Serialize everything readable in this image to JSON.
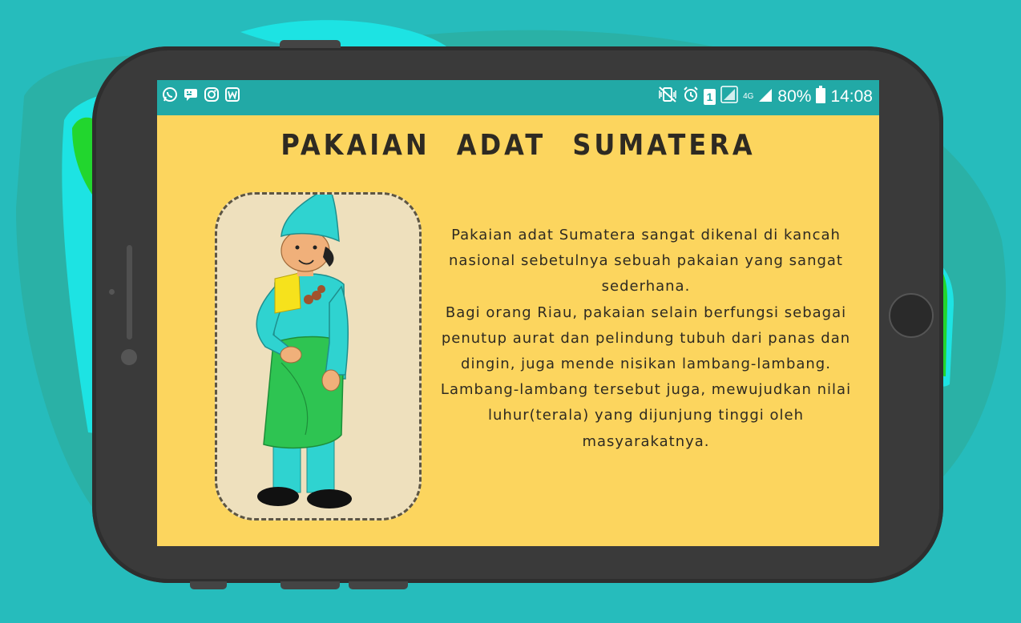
{
  "statusbar": {
    "left_icons": [
      "whatsapp-icon",
      "messenger-icon",
      "instagram-icon",
      "webtoon-icon"
    ],
    "right_icons": [
      "vibrate-mute-icon",
      "alarm-icon",
      "sim-1-icon",
      "signal-icon",
      "4g-signal-icon",
      "battery-icon"
    ],
    "network_label": "4G",
    "sim_label": "1",
    "battery_text": "80%",
    "time": "14:08"
  },
  "page": {
    "title": "PAKAIAN ADAT SUMATERA",
    "description": [
      "Pakaian adat Sumatera sangat dikenal di kancah nasional sebetulnya sebuah pakaian yang sangat sederhana.",
      "Bagi orang Riau, pakaian selain berfungsi sebagai penutup aurat dan pelindung tubuh dari panas dan dingin, juga mende  nisikan lambang-lambang. Lambang-lambang tersebut juga, mewujudkan nilai luhur(terala) yang dijunjung tinggi oleh masyarakatnya."
    ],
    "illustration": "man-in-sumatera-traditional-costume"
  },
  "colors": {
    "background": "#26bcbc",
    "screen": "#fcd55e",
    "statusbar": "#22a9a6",
    "text": "#2e2a22",
    "costume_cyan": "#2fd3d0",
    "sarong_green": "#2ec452",
    "scarf_yellow": "#f6e21c"
  }
}
